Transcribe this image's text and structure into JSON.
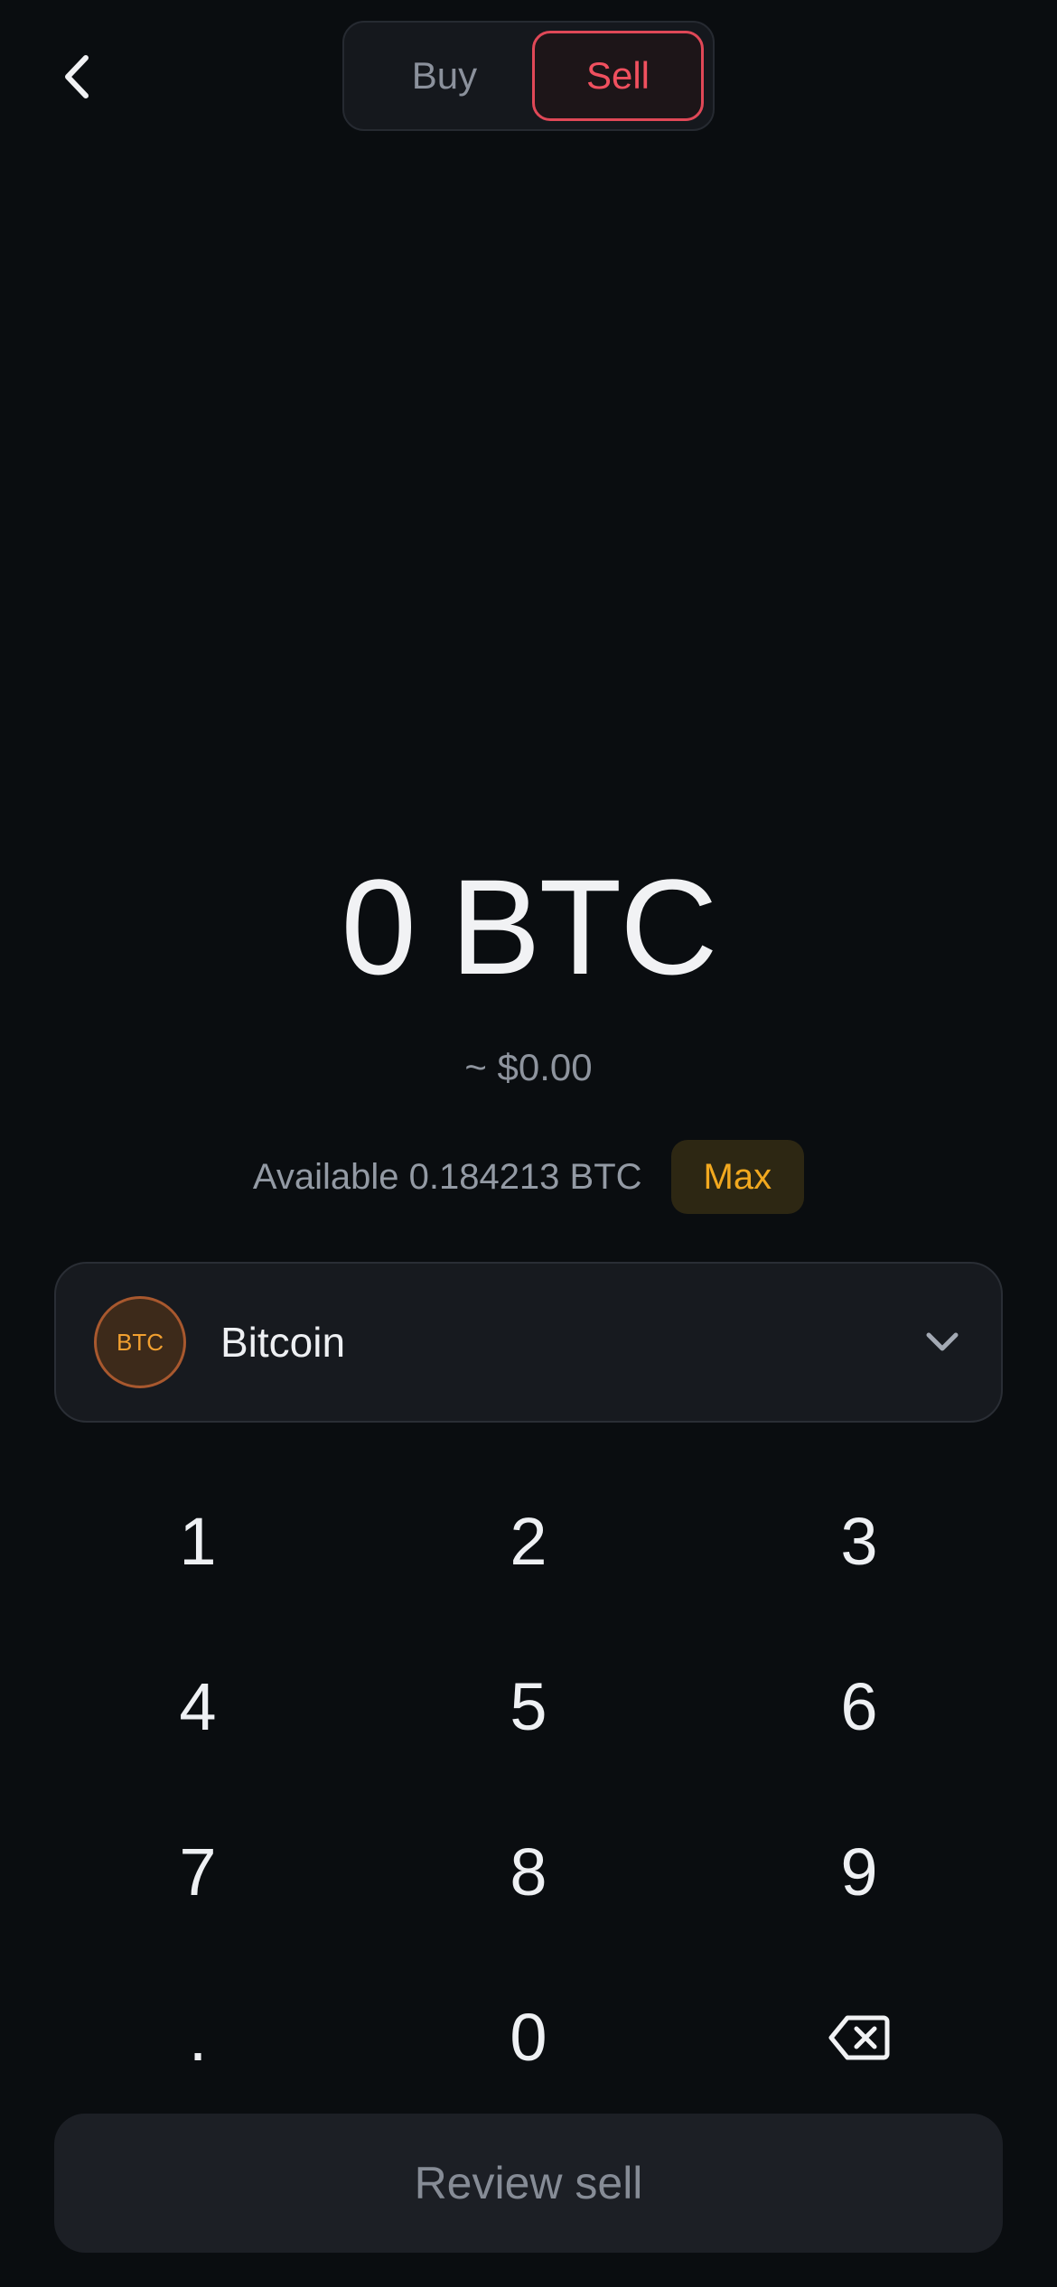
{
  "header": {
    "back_icon": "chevron-left-icon",
    "tabs": [
      {
        "label": "Buy",
        "selected": false
      },
      {
        "label": "Sell",
        "selected": true
      }
    ]
  },
  "amount": {
    "value": "0 BTC",
    "fiat": "~ $0.00",
    "available": "Available 0.184213 BTC",
    "max_label": "Max"
  },
  "asset": {
    "badge": "BTC",
    "name": "Bitcoin",
    "dropdown_icon": "chevron-down-icon"
  },
  "keypad": {
    "keys": [
      "1",
      "2",
      "3",
      "4",
      "5",
      "6",
      "7",
      "8",
      "9",
      ".",
      "0"
    ],
    "backspace_icon": "backspace-icon"
  },
  "cta": {
    "label": "Review sell"
  },
  "colors": {
    "background": "#0a0d10",
    "sell_accent": "#e04857",
    "max_accent": "#f2a91f",
    "btc_badge": "#f2a030"
  }
}
